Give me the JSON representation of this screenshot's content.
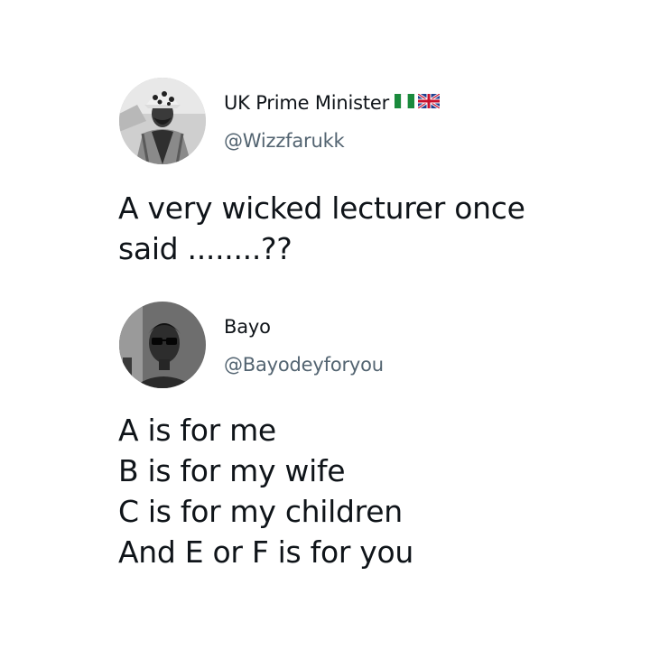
{
  "tweets": [
    {
      "display_name": "UK Prime Minister",
      "handle": "@Wizzfarukk",
      "flags": [
        "nigeria-flag-icon",
        "uk-flag-icon"
      ],
      "text_lines": [
        "A very wicked lecturer once",
        "said ........??"
      ]
    },
    {
      "display_name": "Bayo",
      "handle": "@Bayodeyforyou",
      "flags": [],
      "text_lines": [
        "A is for me",
        "B is for my wife",
        "C is for my children",
        "And E or F is for you"
      ]
    }
  ],
  "colors": {
    "text": "#0f1419",
    "handle": "#536471",
    "background": "#ffffff"
  }
}
